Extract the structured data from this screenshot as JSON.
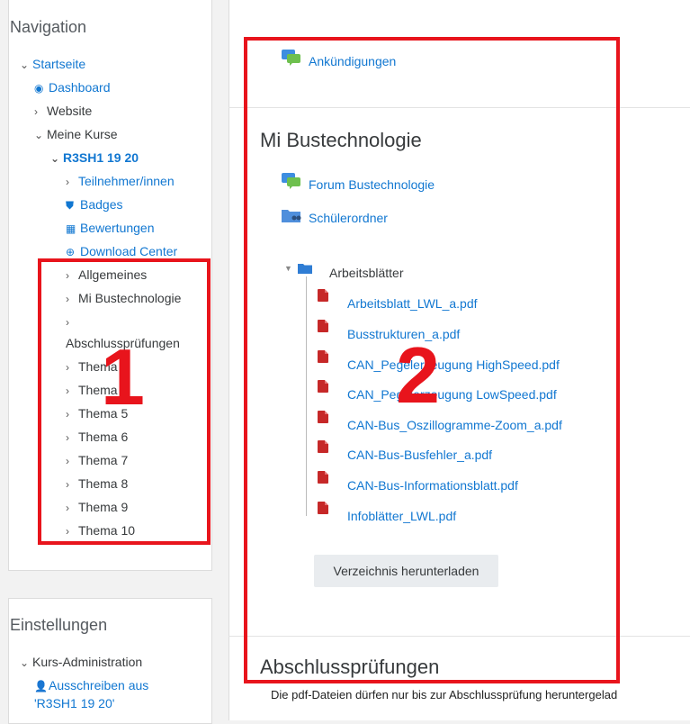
{
  "navigation": {
    "title": "Navigation",
    "items": [
      {
        "label": "Startseite"
      },
      {
        "label": "Dashboard"
      },
      {
        "label": "Website"
      },
      {
        "label": "Meine Kurse"
      },
      {
        "label": "R3SH1 19 20"
      },
      {
        "label": "Teilnehmer/innen"
      },
      {
        "label": "Badges"
      },
      {
        "label": "Bewertungen"
      },
      {
        "label": "Download Center"
      },
      {
        "label": "Allgemeines"
      },
      {
        "label": "Mi Bustechnologie"
      },
      {
        "label": "Abschlussprüfungen"
      },
      {
        "label": "Thema 3"
      },
      {
        "label": "Thema 4"
      },
      {
        "label": "Thema 5"
      },
      {
        "label": "Thema 6"
      },
      {
        "label": "Thema 7"
      },
      {
        "label": "Thema 8"
      },
      {
        "label": "Thema 9"
      },
      {
        "label": "Thema 10"
      }
    ]
  },
  "settings": {
    "title": "Einstellungen",
    "course_admin": "Kurs-Administration",
    "unenrol_line1": "Ausschreiben aus",
    "unenrol_line2": "'R3SH1 19 20'"
  },
  "main": {
    "announcements": "Ankündigungen",
    "section_title": "Mi Bustechnologie",
    "forum": "Forum Bustechnologie",
    "student_folder": "Schülerordner",
    "folder_name": "Arbeitsblätter",
    "files": [
      "Arbeitsblatt_LWL_a.pdf",
      "Busstrukturen_a.pdf",
      "CAN_Pegelerzeugung HighSpeed.pdf",
      "CAN_Pegelerzeugung LowSpeed.pdf",
      "CAN-Bus_Oszillogramme-Zoom_a.pdf",
      "CAN-Bus-Busfehler_a.pdf",
      "CAN-Bus-Informationsblatt.pdf",
      "Infoblätter_LWL.pdf"
    ],
    "download_button": "Verzeichnis herunterladen",
    "next_section_title": "Abschlussprüfungen",
    "next_section_desc": "Die pdf-Dateien dürfen nur bis zur Abschlussprüfung heruntergelad"
  },
  "annotations": {
    "box1": "1",
    "box2": "2"
  },
  "colors": {
    "link": "#1177d1",
    "annotation": "#e8141c"
  }
}
